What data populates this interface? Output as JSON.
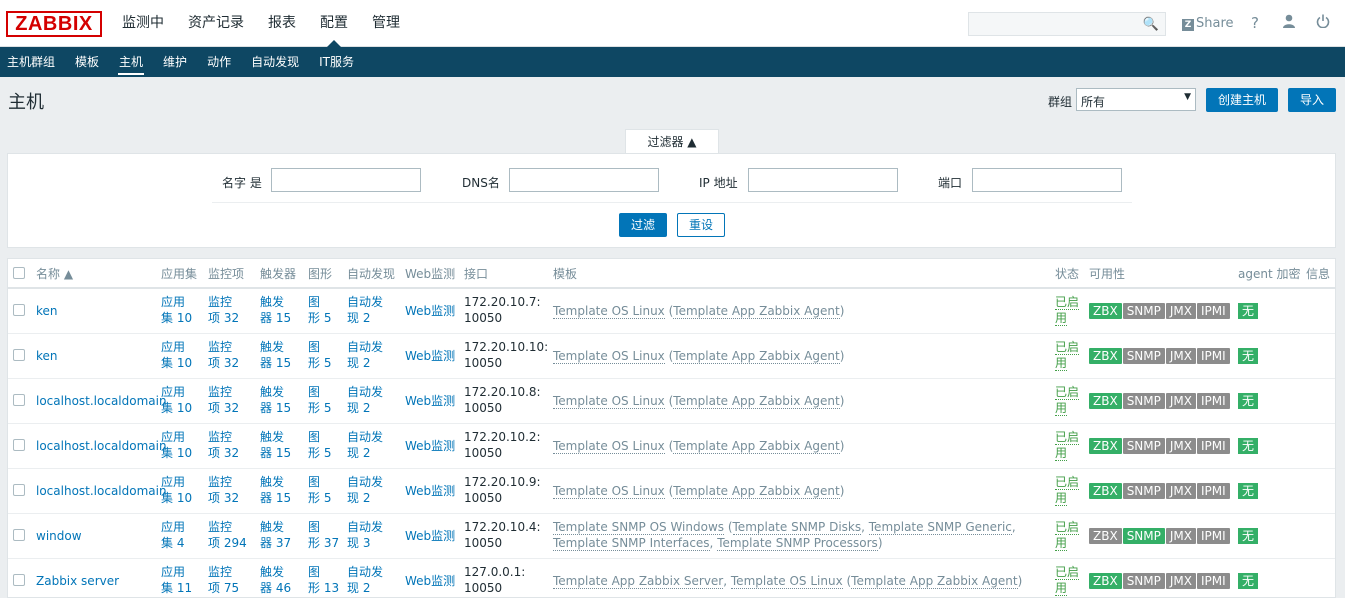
{
  "header": {
    "logo": "ZABBIX",
    "main_menu": [
      "监测中",
      "资产记录",
      "报表",
      "配置",
      "管理"
    ],
    "selected_main": "配置",
    "share": "Share",
    "help_icon": "?"
  },
  "submenu": {
    "items": [
      "主机群组",
      "模板",
      "主机",
      "维护",
      "动作",
      "自动发现",
      "IT服务"
    ],
    "selected": "主机"
  },
  "page": {
    "title": "主机",
    "group_label": "群组",
    "group_value": "所有",
    "create_button": "创建主机",
    "import_button": "导入"
  },
  "filter": {
    "tab_label": "过滤器 ▲",
    "name_label": "名字 是",
    "dns_label": "DNS名",
    "ip_label": "IP 地址",
    "port_label": "端口",
    "apply_button": "过滤",
    "reset_button": "重设"
  },
  "table": {
    "headers": {
      "name": "名称 ▲",
      "apps": "应用集",
      "items": "监控项",
      "triggers": "触发器",
      "graphs": "图形",
      "discovery": "自动发现",
      "web": "Web监测",
      "interface": "接口",
      "templates": "模板",
      "status": "状态",
      "availability": "可用性",
      "agent_enc": "agent 加密",
      "info": "信息"
    },
    "rows": [
      {
        "name": "ken",
        "apps_a": "应用",
        "apps_b": "集 10",
        "items_a": "监控",
        "items_b": "项 32",
        "trig_a": "触发",
        "trig_b": "器 15",
        "graph_a": "图",
        "graph_b": "形 5",
        "disc_a": "自动发",
        "disc_b": "现 2",
        "web": "Web监测",
        "if_a": "172.20.10.7:",
        "if_b": "10050",
        "tmpl_a": "Template OS Linux",
        "tmpl_b": "Template App Zabbix Agent",
        "tmpl_c": "",
        "tmpl_d": "",
        "status_a": "已启",
        "status_b": "用",
        "zbx": "green",
        "snmp": "grey",
        "enc": "无"
      },
      {
        "name": "ken",
        "apps_a": "应用",
        "apps_b": "集 10",
        "items_a": "监控",
        "items_b": "项 32",
        "trig_a": "触发",
        "trig_b": "器 15",
        "graph_a": "图",
        "graph_b": "形 5",
        "disc_a": "自动发",
        "disc_b": "现 2",
        "web": "Web监测",
        "if_a": "172.20.10.10:",
        "if_b": "10050",
        "tmpl_a": "Template OS Linux",
        "tmpl_b": "Template App Zabbix Agent",
        "tmpl_c": "",
        "tmpl_d": "",
        "status_a": "已启",
        "status_b": "用",
        "zbx": "green",
        "snmp": "grey",
        "enc": "无"
      },
      {
        "name": "localhost.localdomain",
        "apps_a": "应用",
        "apps_b": "集 10",
        "items_a": "监控",
        "items_b": "项 32",
        "trig_a": "触发",
        "trig_b": "器 15",
        "graph_a": "图",
        "graph_b": "形 5",
        "disc_a": "自动发",
        "disc_b": "现 2",
        "web": "Web监测",
        "if_a": "172.20.10.8:",
        "if_b": "10050",
        "tmpl_a": "Template OS Linux",
        "tmpl_b": "Template App Zabbix Agent",
        "tmpl_c": "",
        "tmpl_d": "",
        "status_a": "已启",
        "status_b": "用",
        "zbx": "green",
        "snmp": "grey",
        "enc": "无"
      },
      {
        "name": "localhost.localdomain",
        "apps_a": "应用",
        "apps_b": "集 10",
        "items_a": "监控",
        "items_b": "项 32",
        "trig_a": "触发",
        "trig_b": "器 15",
        "graph_a": "图",
        "graph_b": "形 5",
        "disc_a": "自动发",
        "disc_b": "现 2",
        "web": "Web监测",
        "if_a": "172.20.10.2:",
        "if_b": "10050",
        "tmpl_a": "Template OS Linux",
        "tmpl_b": "Template App Zabbix Agent",
        "tmpl_c": "",
        "tmpl_d": "",
        "status_a": "已启",
        "status_b": "用",
        "zbx": "green",
        "snmp": "grey",
        "enc": "无"
      },
      {
        "name": "localhost.localdomain",
        "apps_a": "应用",
        "apps_b": "集 10",
        "items_a": "监控",
        "items_b": "项 32",
        "trig_a": "触发",
        "trig_b": "器 15",
        "graph_a": "图",
        "graph_b": "形 5",
        "disc_a": "自动发",
        "disc_b": "现 2",
        "web": "Web监测",
        "if_a": "172.20.10.9:",
        "if_b": "10050",
        "tmpl_a": "Template OS Linux",
        "tmpl_b": "Template App Zabbix Agent",
        "tmpl_c": "",
        "tmpl_d": "",
        "status_a": "已启",
        "status_b": "用",
        "zbx": "green",
        "snmp": "grey",
        "enc": "无"
      },
      {
        "name": "window",
        "apps_a": "应用",
        "apps_b": "集 4",
        "items_a": "监控",
        "items_b": "项 294",
        "trig_a": "触发",
        "trig_b": "器 37",
        "graph_a": "图",
        "graph_b": "形 37",
        "disc_a": "自动发",
        "disc_b": "现 3",
        "web": "Web监测",
        "if_a": "172.20.10.4:",
        "if_b": "10050",
        "tmpl_a": "Template SNMP OS Windows",
        "tmpl_b": "Template SNMP Disks",
        "tmpl_c": "Template SNMP Generic",
        "tmpl_d": "Template SNMP Interfaces",
        "tmpl_e": "Template SNMP Processors",
        "status_a": "已启",
        "status_b": "用",
        "zbx": "grey",
        "snmp": "green",
        "enc": "无"
      },
      {
        "name": "Zabbix server",
        "apps_a": "应用",
        "apps_b": "集 11",
        "items_a": "监控",
        "items_b": "项 75",
        "trig_a": "触发",
        "trig_b": "器 46",
        "graph_a": "图",
        "graph_b": "形 13",
        "disc_a": "自动发",
        "disc_b": "现 2",
        "web": "Web监测",
        "if_a": "127.0.0.1:",
        "if_b": "10050",
        "tmpl_a": "Template App Zabbix Server",
        "tmpl_b": "Template OS Linux",
        "tmpl_c": "Template App Zabbix Agent",
        "tmpl_d": "",
        "status_a": "已启",
        "status_b": "用",
        "zbx": "green",
        "snmp": "grey",
        "enc": "无"
      }
    ],
    "avail_labels": [
      "ZBX",
      "SNMP",
      "JMX",
      "IPMI"
    ]
  }
}
